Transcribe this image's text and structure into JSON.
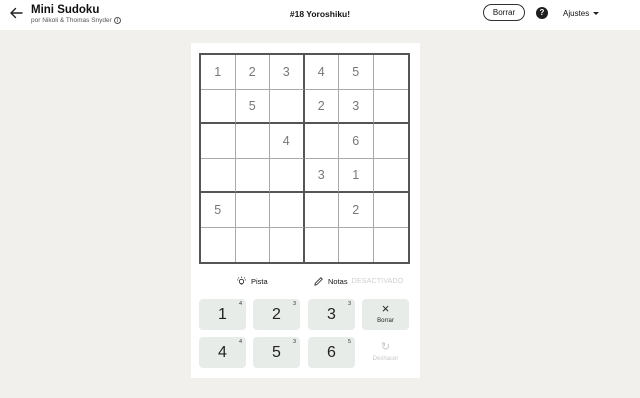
{
  "header": {
    "title": "Mini Sudoku",
    "subtitle": "por Nikoli & Thomas Snyder",
    "puzzle_title": "#18 Yoroshiku!",
    "clear_label": "Borrar",
    "help_label": "?",
    "settings_label": "Ajustes"
  },
  "board": {
    "rows": [
      [
        "1",
        "2",
        "3",
        "4",
        "5",
        ""
      ],
      [
        "",
        "5",
        "",
        "2",
        "3",
        ""
      ],
      [
        "",
        "",
        "4",
        "",
        "6",
        ""
      ],
      [
        "",
        "",
        "",
        "3",
        "1",
        ""
      ],
      [
        "5",
        "",
        "",
        "",
        "2",
        ""
      ],
      [
        "",
        "",
        "",
        "",
        "",
        ""
      ]
    ]
  },
  "tools": {
    "hint_label": "Pista",
    "notes_label": "Notas",
    "notes_state": "DESACTIVADO"
  },
  "keypad": {
    "keys": [
      {
        "label": "1",
        "count": "4"
      },
      {
        "label": "2",
        "count": "3"
      },
      {
        "label": "3",
        "count": "3"
      },
      {
        "label": "4",
        "count": "4"
      },
      {
        "label": "5",
        "count": "3"
      },
      {
        "label": "6",
        "count": "5"
      }
    ],
    "erase_label": "Borrar",
    "erase_icon": "×",
    "undo_label": "Deshacer",
    "undo_icon": "↻"
  }
}
